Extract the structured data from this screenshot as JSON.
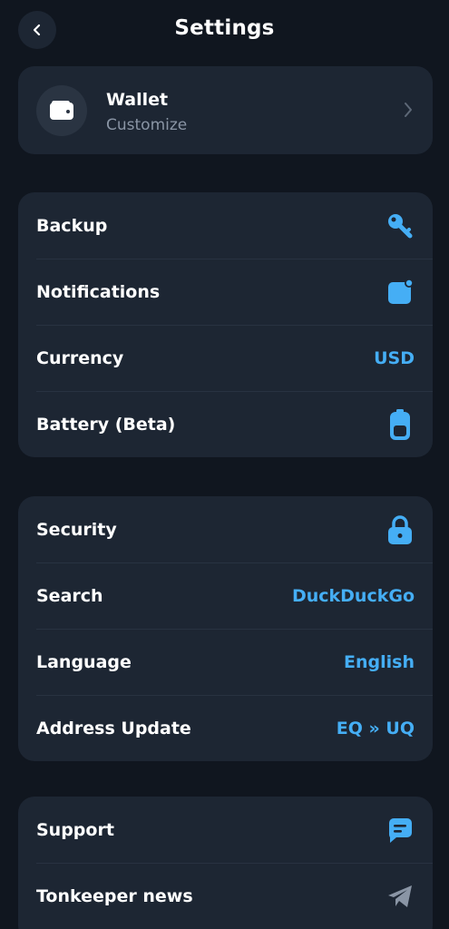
{
  "header": {
    "title": "Settings"
  },
  "wallet": {
    "name": "Wallet",
    "subtitle": "Customize"
  },
  "groups": [
    {
      "items": [
        {
          "label": "Backup",
          "icon": "key-icon"
        },
        {
          "label": "Notifications",
          "icon": "notification-icon"
        },
        {
          "label": "Currency",
          "value": "USD"
        },
        {
          "label": "Battery (Beta)",
          "icon": "battery-icon"
        }
      ]
    },
    {
      "items": [
        {
          "label": "Security",
          "icon": "lock-icon"
        },
        {
          "label": "Search",
          "value": "DuckDuckGo"
        },
        {
          "label": "Language",
          "value": "English"
        },
        {
          "label": "Address Update",
          "value": "EQ » UQ"
        }
      ]
    },
    {
      "items": [
        {
          "label": "Support",
          "icon": "chat-icon"
        },
        {
          "label": "Tonkeeper news",
          "icon": "telegram-icon"
        }
      ]
    }
  ],
  "colors": {
    "background": "#10161f",
    "card": "#1d2633",
    "accent": "#45aef5",
    "secondary_text": "#8a95a5"
  }
}
